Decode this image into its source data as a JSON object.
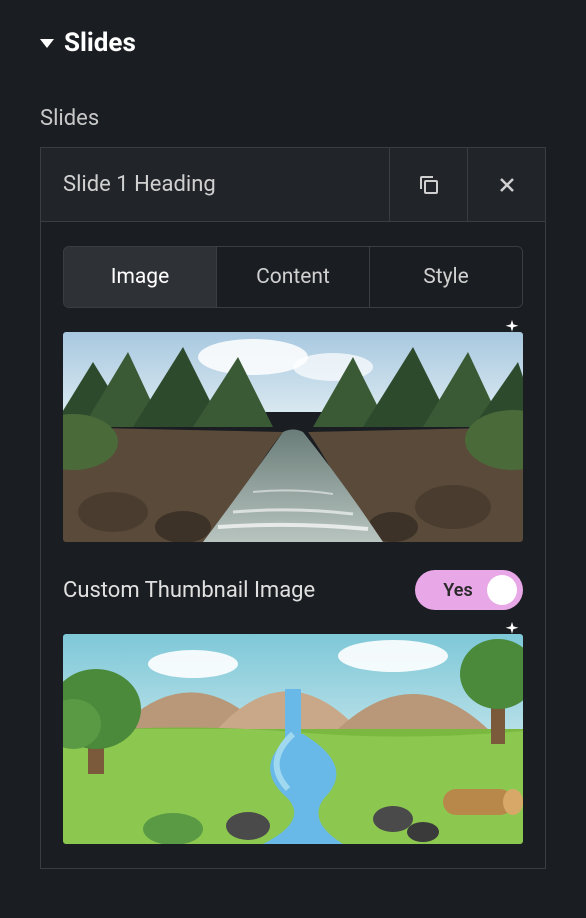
{
  "panel": {
    "title": "Slides"
  },
  "section": {
    "label": "Slides"
  },
  "slide": {
    "heading": "Slide 1 Heading",
    "tabs": {
      "image": "Image",
      "content": "Content",
      "style": "Style"
    },
    "customThumbLabel": "Custom Thumbnail Image",
    "toggle": {
      "yes": "Yes"
    }
  }
}
